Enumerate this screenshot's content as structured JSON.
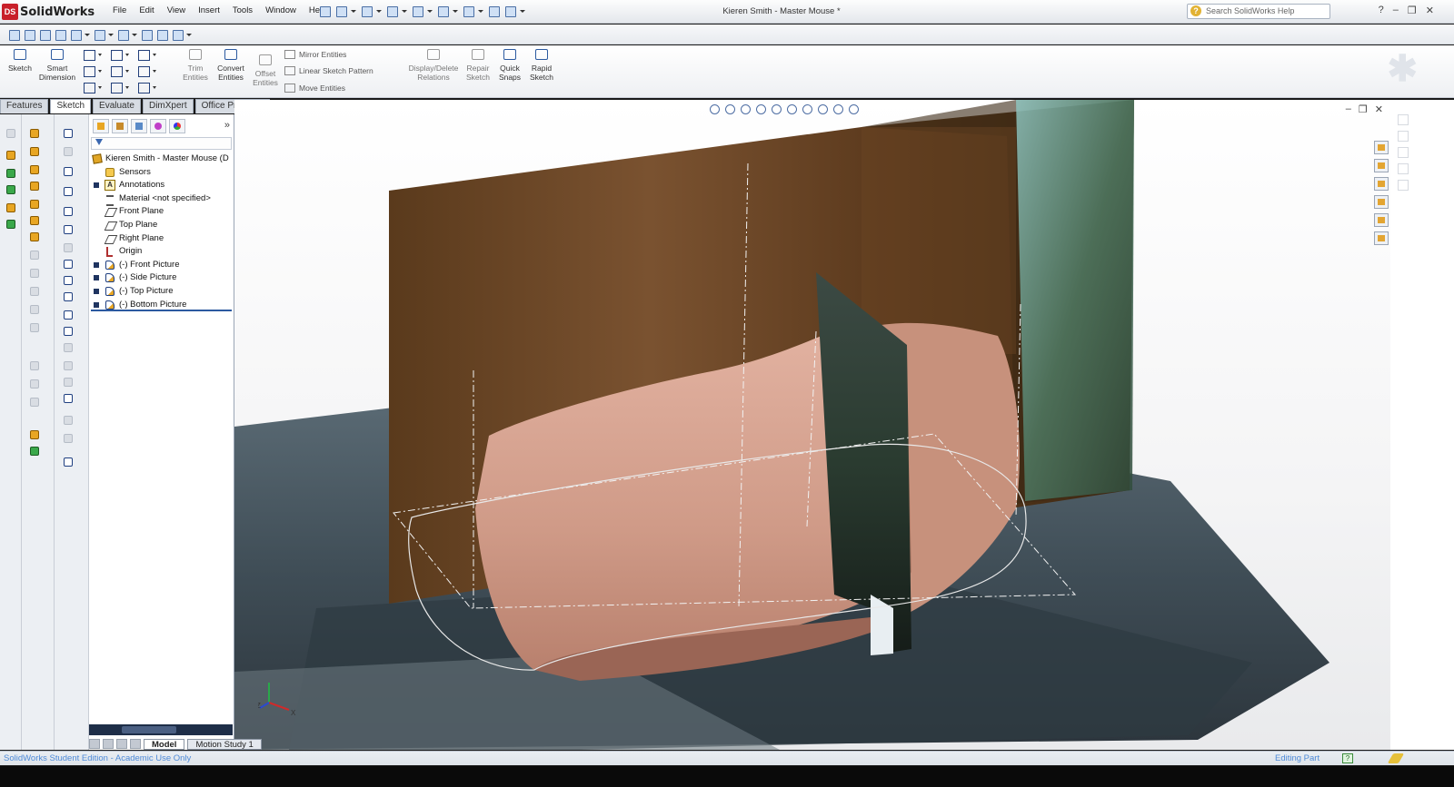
{
  "app": {
    "logo_text": "SolidWorks",
    "logo_mark": "DS"
  },
  "menu": [
    "File",
    "Edit",
    "View",
    "Insert",
    "Tools",
    "Window",
    "Help"
  ],
  "document_title": "Kieren Smith - Master Mouse *",
  "help_search": {
    "placeholder": "Search SolidWorks Help"
  },
  "command_manager": {
    "sketch": "Sketch",
    "smart_dimension": [
      "Smart",
      "Dimension"
    ],
    "trim_entities": [
      "Trim",
      "Entities"
    ],
    "convert_entities": [
      "Convert",
      "Entities"
    ],
    "offset_entities": [
      "Offset",
      "Entities"
    ],
    "mirror_entities": "Mirror Entities",
    "linear_sketch_pattern": "Linear Sketch Pattern",
    "move_entities": "Move Entities",
    "display_delete_relations": [
      "Display/Delete",
      "Relations"
    ],
    "repair_sketch": [
      "Repair",
      "Sketch"
    ],
    "quick_snaps": [
      "Quick",
      "Snaps"
    ],
    "rapid_sketch": [
      "Rapid",
      "Sketch"
    ]
  },
  "tabs": [
    "Features",
    "Sketch",
    "Evaluate",
    "DimXpert",
    "Office Products"
  ],
  "active_tab": "Sketch",
  "feature_tree": {
    "root": "Kieren Smith - Master Mouse  (D",
    "items": [
      {
        "label": "Sensors",
        "icon": "sensors-icon",
        "expandable": false
      },
      {
        "label": "Annotations",
        "icon": "annotations-icon",
        "expandable": true
      },
      {
        "label": "Material <not specified>",
        "icon": "material-icon",
        "expandable": false
      },
      {
        "label": "Front Plane",
        "icon": "plane-icon",
        "expandable": false
      },
      {
        "label": "Top Plane",
        "icon": "plane-icon",
        "expandable": false
      },
      {
        "label": "Right Plane",
        "icon": "plane-icon",
        "expandable": false
      },
      {
        "label": "Origin",
        "icon": "origin-icon",
        "expandable": false
      },
      {
        "label": "(-) Front Picture",
        "icon": "sketch-picture-icon",
        "expandable": true
      },
      {
        "label": "(-) Side Picture",
        "icon": "sketch-picture-icon",
        "expandable": true
      },
      {
        "label": "(-) Top Picture",
        "icon": "sketch-picture-icon",
        "expandable": true
      },
      {
        "label": "(-) Bottom Picture",
        "icon": "sketch-picture-icon",
        "expandable": true
      }
    ]
  },
  "bottom_tabs": [
    "Model",
    "Motion Study 1"
  ],
  "status": {
    "left": "SolidWorks Student Edition - Academic Use Only",
    "right": "Editing Part",
    "help_glyph": "?"
  },
  "triad": {
    "z": "Z",
    "x": "X"
  },
  "colors": {
    "accent_blue": "#2c5aa0",
    "status_text": "#4f8bd8",
    "brand_red": "#c8202a",
    "mouse_pink": "#d9a08e",
    "wood_brown": "#6b4523"
  }
}
